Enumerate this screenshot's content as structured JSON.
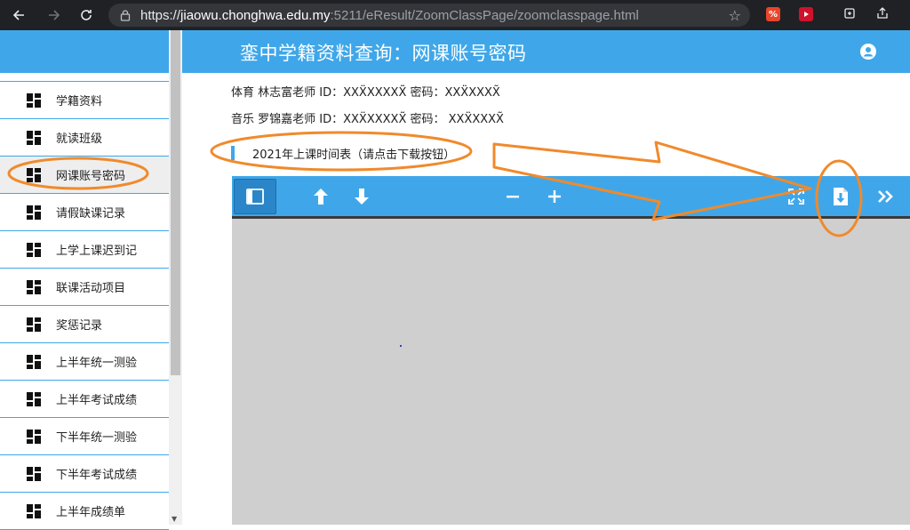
{
  "browser": {
    "url_prefix": "https://",
    "url_host": "jiaowu.chonghwa.edu.my",
    "url_path": ":5211/eResult/ZoomClassPage/zoomclasspage.html",
    "extension_badge": "%"
  },
  "header": {
    "title": "銮中学籍资料查询：网课账号密码"
  },
  "sidebar": {
    "items": [
      {
        "label": "学籍资料"
      },
      {
        "label": "就读班级"
      },
      {
        "label": "网课账号密码"
      },
      {
        "label": "请假缺课记录"
      },
      {
        "label": "上学上课迟到记"
      },
      {
        "label": "联课活动项目"
      },
      {
        "label": "奖惩记录"
      },
      {
        "label": "上半年统一测验"
      },
      {
        "label": "上半年考试成绩"
      },
      {
        "label": "下半年统一测验"
      },
      {
        "label": "下半年考试成绩"
      },
      {
        "label": "上半年成绩单"
      }
    ],
    "active_index": 2
  },
  "accounts": [
    {
      "text": "体育 林志富老师 ID：XXẌXXXXX̃ 密码：XXẌXXXX̃"
    },
    {
      "text": "音乐 罗锦嘉老师 ID：XXẌXXXXX̃ 密码： XXẌXXXX̃"
    }
  ],
  "schedule": {
    "label": "2021年上课时间表（请点击下载按钮）"
  },
  "viewer": {
    "icons": [
      "sidebar-toggle-icon",
      "arrow-up-icon",
      "arrow-down-icon",
      "zoom-out-icon",
      "zoom-in-icon",
      "fullscreen-icon",
      "download-icon",
      "more-tools-icon"
    ]
  },
  "colors": {
    "accent": "#3fa7e9",
    "annotation": "#f08a2c",
    "viewer_bg": "#cfcfcf"
  }
}
